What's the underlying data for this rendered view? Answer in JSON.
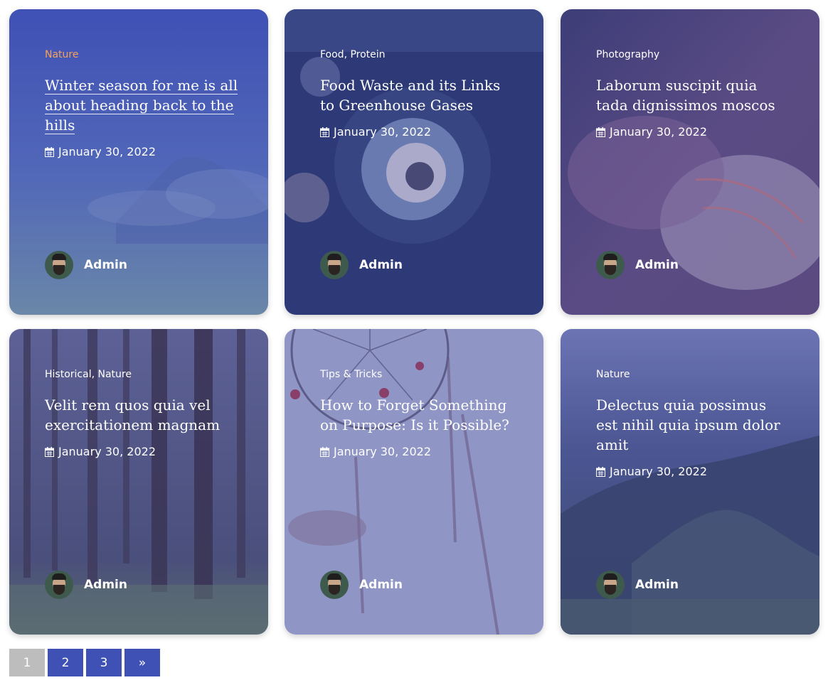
{
  "posts": [
    {
      "category": "Nature",
      "title": "Winter season for me is all about heading back to the hills",
      "date": "January 30, 2022",
      "author": "Admin"
    },
    {
      "category": "Food, Protein",
      "title": "Food Waste and its Links to Greenhouse Gases",
      "date": "January 30, 2022",
      "author": "Admin"
    },
    {
      "category": "Photography",
      "title": "Laborum suscipit quia tada dignissimos moscos",
      "date": "January 30, 2022",
      "author": "Admin"
    },
    {
      "category": "Historical, Nature",
      "title": "Velit rem quos quia vel exercitationem magnam",
      "date": "January 30, 2022",
      "author": "Admin"
    },
    {
      "category": "Tips & Tricks",
      "title": "How to Forget Something on Purpose: Is it Possible?",
      "date": "January 30, 2022",
      "author": "Admin"
    },
    {
      "category": "Nature",
      "title": "Delectus quia possimus est nihil quia ipsum dolor amit",
      "date": "January 30, 2022",
      "author": "Admin"
    }
  ],
  "pagination": {
    "current": "1",
    "pages": [
      "2",
      "3"
    ],
    "next": "»"
  },
  "colors": {
    "accent": "#3f51b5",
    "category_highlight": "#f7a25a",
    "pager_current": "#bdbdbd"
  }
}
